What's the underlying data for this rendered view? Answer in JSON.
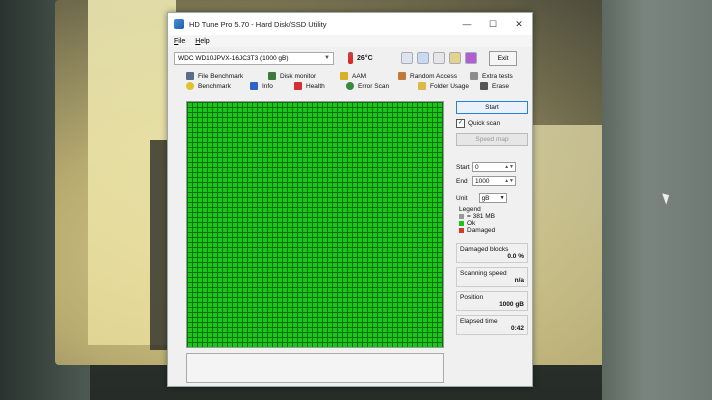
{
  "window": {
    "title": "HD Tune Pro 5.70 - Hard Disk/SSD Utility",
    "controls": {
      "minimize": "—",
      "maximize": "☐",
      "close": "✕"
    }
  },
  "menu": [
    "File",
    "Help"
  ],
  "toolbar": {
    "drive": "WDC WD10JPVX-16JC3T3 (1000 gB)",
    "temperature": "26°C",
    "exit_label": "Exit"
  },
  "tabs": {
    "row1": [
      "File Benchmark",
      "Disk monitor",
      "AAM",
      "Random Access",
      "Extra tests"
    ],
    "row2": [
      "Benchmark",
      "Info",
      "Health",
      "Error Scan",
      "Folder Usage",
      "Erase"
    ]
  },
  "side": {
    "start_label": "Start",
    "quick_scan_label": "Quick scan",
    "speed_map_label": "Speed map",
    "start_field_label": "Start",
    "start_value": "0",
    "end_field_label": "End",
    "end_value": "1000",
    "unit_label": "Unit",
    "unit_value": "gB",
    "legend_title": "Legend",
    "legend_block": "= 381 MB",
    "legend_ok": "Ok",
    "legend_damaged": "Damaged",
    "damaged_blocks_label": "Damaged blocks",
    "damaged_blocks_value": "0.0 %",
    "scanning_speed_label": "Scanning speed",
    "scanning_speed_value": "n/a",
    "position_label": "Position",
    "position_value": "1000 gB",
    "elapsed_label": "Elapsed time",
    "elapsed_value": "0:42"
  },
  "colors": {
    "ok_block": "#17c817",
    "damaged_block": "#d23a2a",
    "accent": "#2b7fd4"
  }
}
